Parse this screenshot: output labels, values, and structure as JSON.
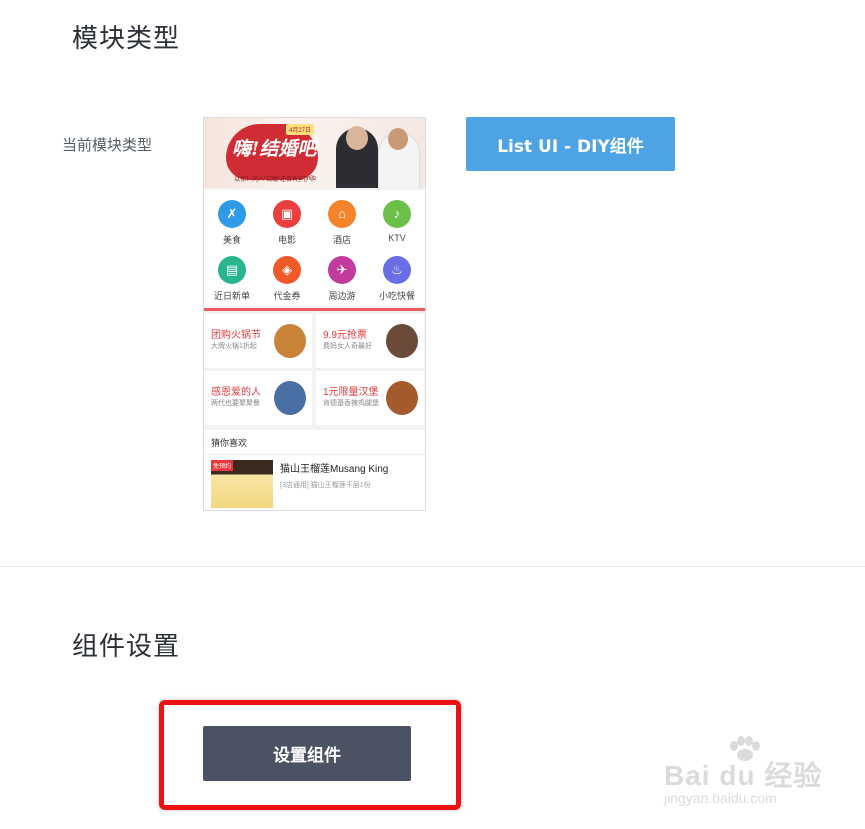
{
  "module_type_section": {
    "title": "模块类型",
    "current_type_label": "当前模块类型",
    "type_button_label": "List UI - DIY组件"
  },
  "preview": {
    "banner": {
      "title": "嗨!结婚吧",
      "tag": "4月27日",
      "subtitle": "以你！向人“试婚”还会有些团购"
    },
    "categories": [
      {
        "label": "美食",
        "icon": "fork-knife-icon",
        "color": "#2f9be6",
        "glyph": "✗"
      },
      {
        "label": "电影",
        "icon": "film-icon",
        "color": "#ec3e3e",
        "glyph": "▣"
      },
      {
        "label": "酒店",
        "icon": "hotel-icon",
        "color": "#f5832a",
        "glyph": "⌂"
      },
      {
        "label": "KTV",
        "icon": "microphone-icon",
        "color": "#6cc04a",
        "glyph": "♪"
      },
      {
        "label": "近日新单",
        "icon": "clipboard-icon",
        "color": "#28b58f",
        "glyph": "▤"
      },
      {
        "label": "代金券",
        "icon": "coupon-tag-icon",
        "color": "#f05a2a",
        "glyph": "◈"
      },
      {
        "label": "周边游",
        "icon": "plane-icon",
        "color": "#c23b9c",
        "glyph": "✈"
      },
      {
        "label": "小吃快餐",
        "icon": "drink-cup-icon",
        "color": "#6a6ee6",
        "glyph": "♨"
      }
    ],
    "promos": [
      {
        "title": "团购火锅节",
        "subtitle": "大牌火锅1折起",
        "title_color": "#e03c3c",
        "icon": "hotpot-image"
      },
      {
        "title": "9.9元抢票",
        "subtitle": "费妈女人奇最好",
        "title_color": "#e03c3c",
        "icon": "woman-portrait-image"
      },
      {
        "title": "感恩爱的人",
        "subtitle": "两代也要聚聚餐",
        "title_color": "#e03c3c",
        "icon": "family-photo-image"
      },
      {
        "title": "1元限量汉堡",
        "subtitle": "肯德基香辣鸡腿堡",
        "title_color": "#e03c3c",
        "icon": "burger-image"
      }
    ],
    "guess": {
      "heading": "猜你喜欢",
      "tag": "免预约",
      "deal_title": "猫山王榴莲Musang King",
      "deal_subtitle": "[3店通用] 猫山王榴莲千层1份"
    }
  },
  "component_section": {
    "title": "组件设置",
    "settings_button_label": "设置组件"
  },
  "watermark": {
    "brand": "Bai du 经验",
    "url": "jingyan.baidu.com"
  },
  "colors": {
    "type_button": "#4da3e3",
    "settings_button": "#4a5263",
    "highlight_border": "#ee1111"
  }
}
